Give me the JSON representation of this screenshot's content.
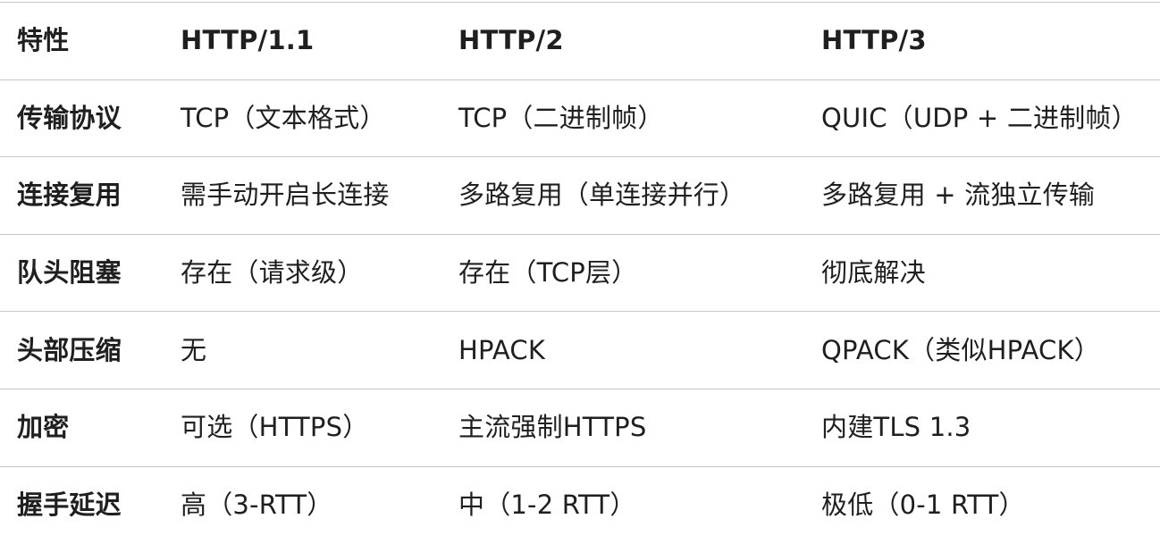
{
  "table": {
    "headers": [
      "特性",
      "HTTP/1.1",
      "HTTP/2",
      "HTTP/3"
    ],
    "rows": [
      [
        "传输协议",
        "TCP（文本格式）",
        "TCP（二进制帧）",
        "QUIC（UDP + 二进制帧）"
      ],
      [
        "连接复用",
        "需手动开启长连接",
        "多路复用（单连接并行）",
        "多路复用 + 流独立传输"
      ],
      [
        "队头阻塞",
        "存在（请求级）",
        "存在（TCP层）",
        "彻底解决"
      ],
      [
        "头部压缩",
        "无",
        "HPACK",
        "QPACK（类似HPACK）"
      ],
      [
        "加密",
        "可选（HTTPS）",
        "主流强制HTTPS",
        "内建TLS 1.3"
      ],
      [
        "握手延迟",
        "高（3-RTT）",
        "中（1-2 RTT）",
        "极低（0-1 RTT）"
      ]
    ]
  }
}
